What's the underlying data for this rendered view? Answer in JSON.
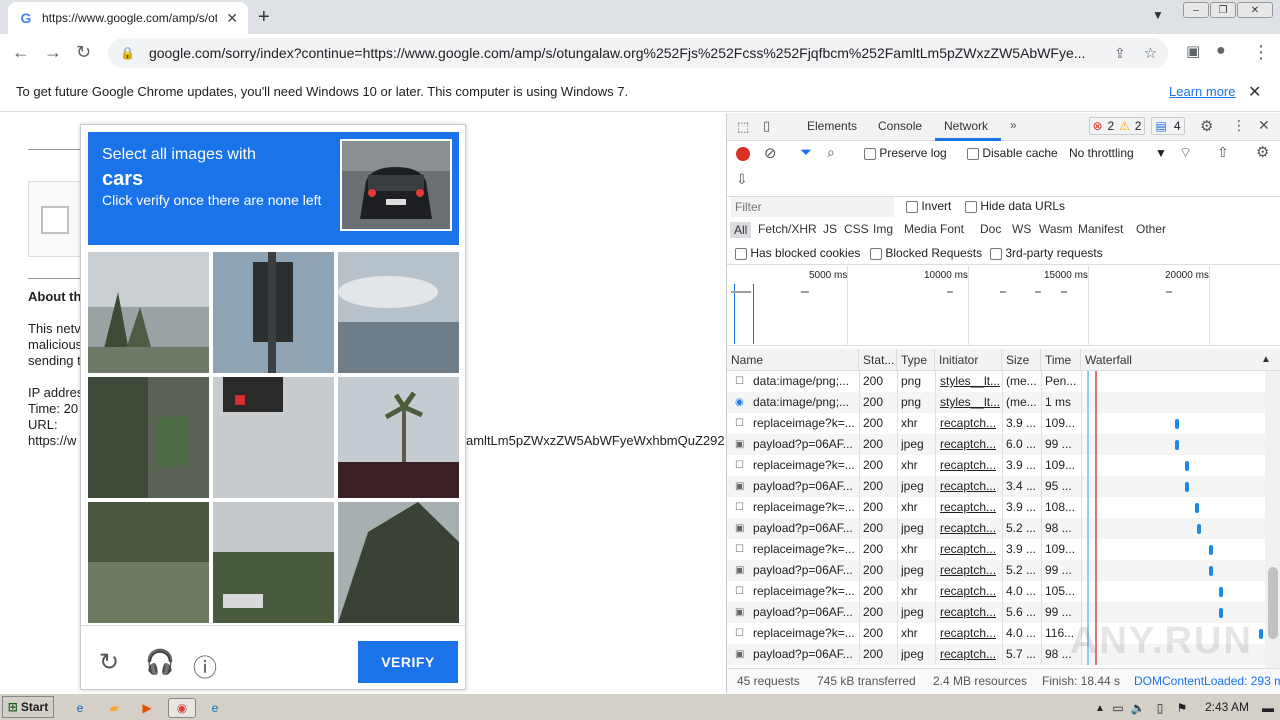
{
  "browser": {
    "tab_title": "https://www.google.com/amp/s/otu",
    "tab_favicon": "G",
    "url": "google.com/sorry/index?continue=https://www.google.com/amp/s/otungalaw.org%252Fjs%252Fcss%252Fjqfbcm%252FamltLm5pZWxzZW5AbWFye...",
    "infobar_text": "To get future Google Chrome updates, you'll need Windows 10 or later. This computer is using Windows 7.",
    "infobar_link": "Learn more"
  },
  "page": {
    "about_heading": "About th",
    "para1": "This netv",
    "para2": "malicious",
    "para3": "sending t",
    "ip_label": "IP addres",
    "time_label": "Time: 20",
    "url_label": "URL:",
    "url_value": "https://w",
    "url_tail": "amltLm5pZWxzZW5AbWFyeWxhbmQuZ292"
  },
  "captcha": {
    "line1": "Select all images with",
    "target": "cars",
    "line3": "Click verify once there are none left",
    "verify_label": "VERIFY"
  },
  "devtools": {
    "tabs": [
      "Elements",
      "Console",
      "Network"
    ],
    "active_tab": "Network",
    "errors": "2",
    "warnings": "2",
    "messages": "4",
    "preserve_log": "Preserve log",
    "disable_cache": "Disable cache",
    "throttling": "No throttling",
    "filter_placeholder": "Filter",
    "invert": "Invert",
    "hide_data_urls": "Hide data URLs",
    "types": [
      "All",
      "Fetch/XHR",
      "JS",
      "CSS",
      "Img",
      "Media",
      "Font",
      "Doc",
      "WS",
      "Wasm",
      "Manifest",
      "Other"
    ],
    "has_blocked_cookies": "Has blocked cookies",
    "blocked_requests": "Blocked Requests",
    "third_party": "3rd-party requests",
    "timeline_ticks": [
      "5000 ms",
      "10000 ms",
      "15000 ms",
      "20000 ms"
    ],
    "columns": [
      "Name",
      "Stat...",
      "Type",
      "Initiator",
      "Size",
      "Time",
      "Waterfall"
    ],
    "rows": [
      {
        "name": "data:image/png;...",
        "status": "200",
        "type": "png",
        "initiator": "styles__lt...",
        "size": "(me...",
        "time": "Pen..."
      },
      {
        "name": "data:image/png;...",
        "status": "200",
        "type": "png",
        "initiator": "styles__lt...",
        "size": "(me...",
        "time": "1 ms"
      },
      {
        "name": "replaceimage?k=...",
        "status": "200",
        "type": "xhr",
        "initiator": "recaptch...",
        "size": "3.9 ...",
        "time": "109..."
      },
      {
        "name": "payload?p=06AF...",
        "status": "200",
        "type": "jpeg",
        "initiator": "recaptch...",
        "size": "6.0 ...",
        "time": "99 ..."
      },
      {
        "name": "replaceimage?k=...",
        "status": "200",
        "type": "xhr",
        "initiator": "recaptch...",
        "size": "3.9 ...",
        "time": "109..."
      },
      {
        "name": "payload?p=06AF...",
        "status": "200",
        "type": "jpeg",
        "initiator": "recaptch...",
        "size": "3.4 ...",
        "time": "95 ..."
      },
      {
        "name": "replaceimage?k=...",
        "status": "200",
        "type": "xhr",
        "initiator": "recaptch...",
        "size": "3.9 ...",
        "time": "108..."
      },
      {
        "name": "payload?p=06AF...",
        "status": "200",
        "type": "jpeg",
        "initiator": "recaptch...",
        "size": "5.2 ...",
        "time": "98 ..."
      },
      {
        "name": "replaceimage?k=...",
        "status": "200",
        "type": "xhr",
        "initiator": "recaptch...",
        "size": "3.9 ...",
        "time": "109..."
      },
      {
        "name": "payload?p=06AF...",
        "status": "200",
        "type": "jpeg",
        "initiator": "recaptch...",
        "size": "5.2 ...",
        "time": "99 ..."
      },
      {
        "name": "replaceimage?k=...",
        "status": "200",
        "type": "xhr",
        "initiator": "recaptch...",
        "size": "4.0 ...",
        "time": "105..."
      },
      {
        "name": "payload?p=06AF...",
        "status": "200",
        "type": "jpeg",
        "initiator": "recaptch...",
        "size": "5.6 ...",
        "time": "99 ..."
      },
      {
        "name": "replaceimage?k=...",
        "status": "200",
        "type": "xhr",
        "initiator": "recaptch...",
        "size": "4.0 ...",
        "time": "116..."
      },
      {
        "name": "payload?p=06AF...",
        "status": "200",
        "type": "jpeg",
        "initiator": "recaptch...",
        "size": "5.7 ...",
        "time": "98 ..."
      }
    ],
    "status": {
      "requests": "45 requests",
      "transferred": "745 kB transferred",
      "resources": "2.4 MB resources",
      "finish": "Finish: 18.44 s",
      "dcl": "DOMContentLoaded: 293 m"
    }
  },
  "taskbar": {
    "start": "Start",
    "clock": "2:43 AM"
  },
  "watermark": "ANY.RUN"
}
